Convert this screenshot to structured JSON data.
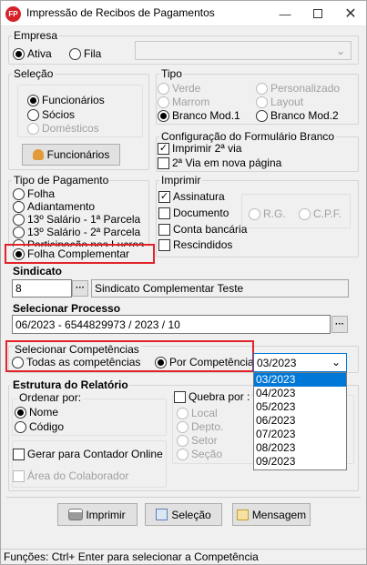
{
  "window": {
    "title": "Impressão de Recibos de Pagamentos",
    "icon_label": "FP"
  },
  "empresa": {
    "legend": "Empresa",
    "ativa": "Ativa",
    "fila": "Fila"
  },
  "selecao": {
    "legend": "Seleção",
    "funcionarios": "Funcionários",
    "socios": "Sócios",
    "domesticos": "Domésticos",
    "button": "Funcionários"
  },
  "tipo": {
    "legend": "Tipo",
    "verde": "Verde",
    "marrom": "Marrom",
    "branco1": "Branco Mod.1",
    "personalizado": "Personalizado",
    "layout": "Layout",
    "branco2": "Branco Mod.2"
  },
  "config": {
    "legend": "Configuração do Formulário Branco",
    "imprimir2via": "Imprimir 2ª via",
    "segundaVia": "2ª Via em nova página"
  },
  "tipoPagamento": {
    "legend": "Tipo de Pagamento",
    "items": [
      "Folha",
      "Adiantamento",
      "13º Salário - 1ª Parcela",
      "13º Salário - 2ª Parcela",
      "Participação nos Lucros",
      "Folha Complementar"
    ]
  },
  "imprimir": {
    "legend": "Imprimir",
    "assinatura": "Assinatura",
    "documento": "Documento",
    "rg": "R.G.",
    "cpf": "C.P.F.",
    "contaBancaria": "Conta bancária",
    "rescindidos": "Rescindidos"
  },
  "sindicato": {
    "label": "Sindicato",
    "code": "8",
    "name": "Sindicato Complementar Teste"
  },
  "processo": {
    "label": "Selecionar Processo",
    "value": "06/2023 - 6544829973 / 2023 / 10"
  },
  "competencias": {
    "legend": "Selecionar Competências",
    "todas": "Todas as competências",
    "porCompetencia": "Por Competência",
    "selected": "03/2023",
    "options": [
      "03/2023",
      "04/2023",
      "05/2023",
      "06/2023",
      "07/2023",
      "08/2023",
      "09/2023"
    ]
  },
  "estrutura": {
    "legend": "Estrutura do Relatório",
    "ordenar": "Ordenar por:",
    "nome": "Nome",
    "codigo": "Código",
    "quebra": "Quebra por :",
    "local": "Local",
    "depto": "Depto.",
    "setor": "Setor",
    "secao": "Seção",
    "gerar": "Gerar para Contador Online",
    "area": "Área do Colaborador"
  },
  "buttons": {
    "imprimir": "Imprimir",
    "selecao": "Seleção",
    "mensagem": "Mensagem"
  },
  "status": {
    "text": "Funções:  Ctrl+ Enter para selecionar a Competência"
  },
  "colors": {
    "highlight_red": "#e2232a",
    "selection_blue": "#0078d7"
  }
}
